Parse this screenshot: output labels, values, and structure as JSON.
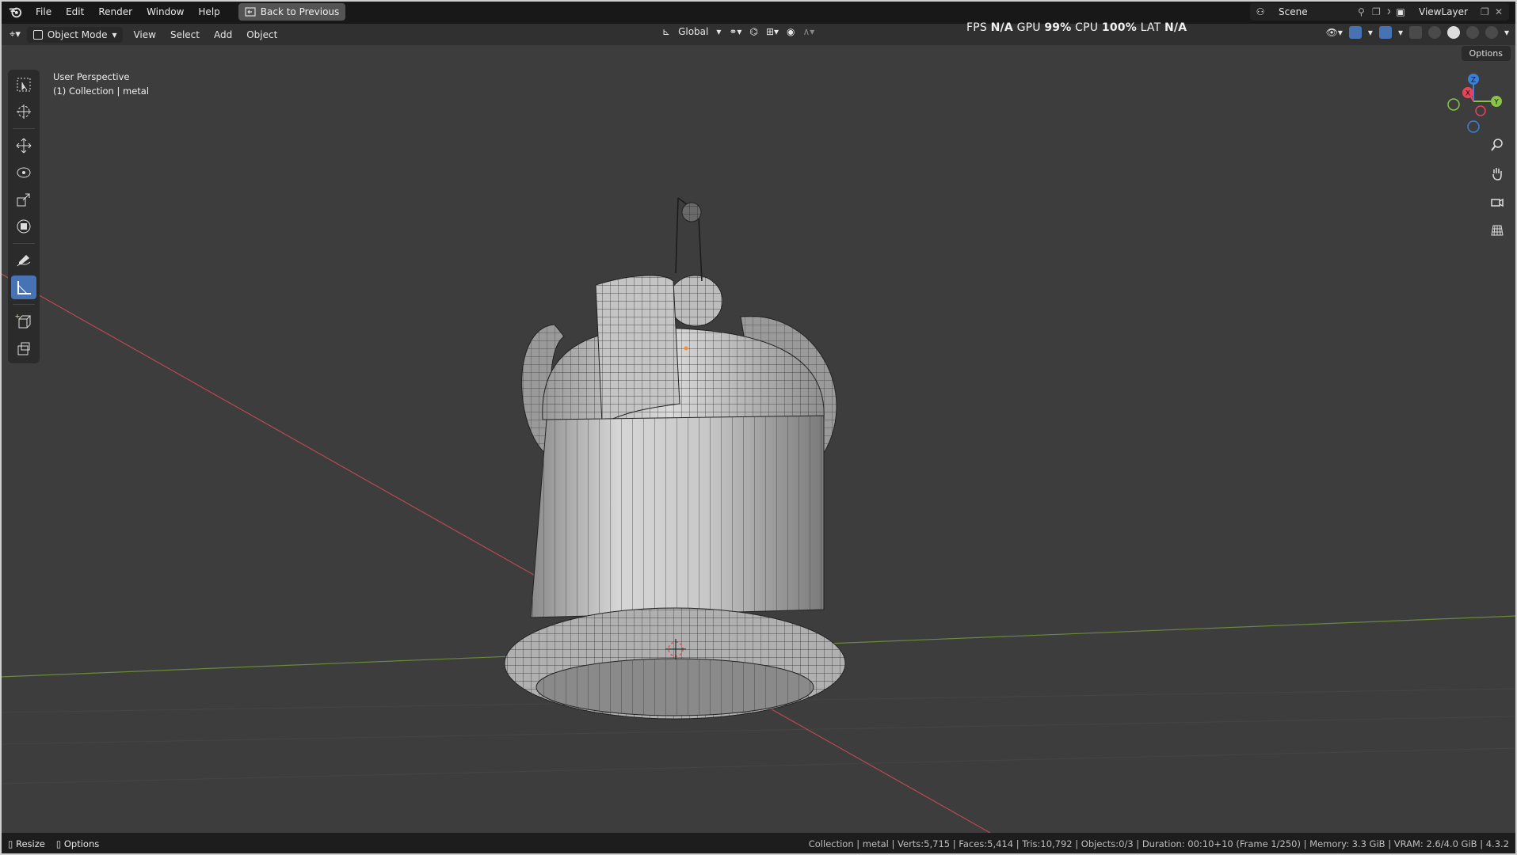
{
  "menu": {
    "items": [
      "File",
      "Edit",
      "Render",
      "Window",
      "Help"
    ],
    "back_button": "Back to Previous"
  },
  "top_right": {
    "scene": "Scene",
    "view_layer": "ViewLayer"
  },
  "header": {
    "mode": "Object Mode",
    "items": [
      "View",
      "Select",
      "Add",
      "Object"
    ],
    "transform_orientation": "Global"
  },
  "stats": {
    "fps_label": "FPS",
    "fps_value": "N/A",
    "gpu_label": "GPU",
    "gpu_value": "99%",
    "cpu_label": "CPU",
    "cpu_value": "100%",
    "lat_label": "LAT",
    "lat_value": "N/A"
  },
  "viewport": {
    "options": "Options",
    "view_name": "User Perspective",
    "collection_info": "(1) Collection | metal"
  },
  "status_bar": {
    "resize": "Resize",
    "options": "Options",
    "info": "Collection | metal | Verts:5,715 | Faces:5,414 | Tris:10,792 | Objects:0/3 | Duration: 00:10+10 (Frame 1/250) | Memory: 3.3 GiB | VRAM: 2.6/4.0 GiB | 4.3.2"
  },
  "gizmo": {
    "x": "X",
    "y": "Y",
    "z": "Z",
    "x_color": "#e8435a",
    "y_color": "#8bc34a",
    "z_color": "#3c7fd6"
  },
  "icons": {
    "toolbar": [
      "select-box-icon",
      "cursor-icon",
      "move-icon",
      "rotate-icon",
      "scale-icon",
      "transform-icon",
      "annotate-icon",
      "measure-icon",
      "add-cube-icon",
      "add-object-icon"
    ],
    "nav": [
      "zoom-icon",
      "pan-icon",
      "camera-icon",
      "grid-icon"
    ]
  }
}
